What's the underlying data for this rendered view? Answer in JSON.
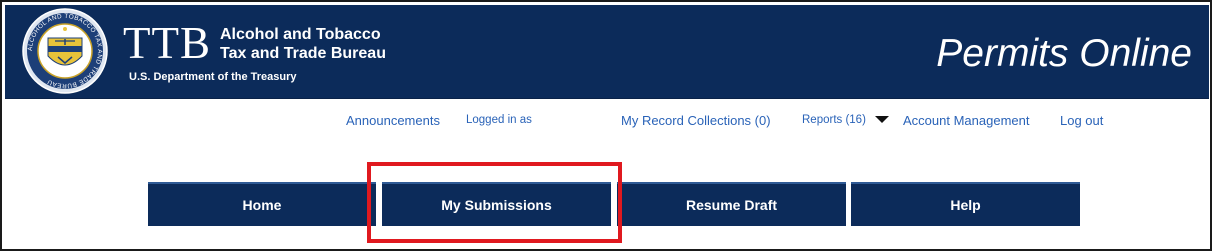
{
  "header": {
    "agency_mark": "TTB",
    "agency_name_line1": "Alcohol and Tobacco",
    "agency_name_line2": "Tax and Trade Bureau",
    "department": "U.S. Department of the Treasury",
    "app_title": "Permits Online",
    "seal_text": "ALCOHOL AND TOBACCO TAX AND TRADE BUREAU"
  },
  "utility_links": {
    "announcements": "Announcements",
    "logged_in": "Logged in as",
    "record_collections": "My Record Collections (0)",
    "reports": "Reports (16)",
    "account_management": "Account Management",
    "logout": "Log out"
  },
  "nav": {
    "home": "Home",
    "my_submissions": "My Submissions",
    "resume_draft": "Resume Draft",
    "help": "Help"
  },
  "colors": {
    "header_bg": "#0c2b5a",
    "link": "#2a63b8",
    "highlight": "#e0191f"
  }
}
